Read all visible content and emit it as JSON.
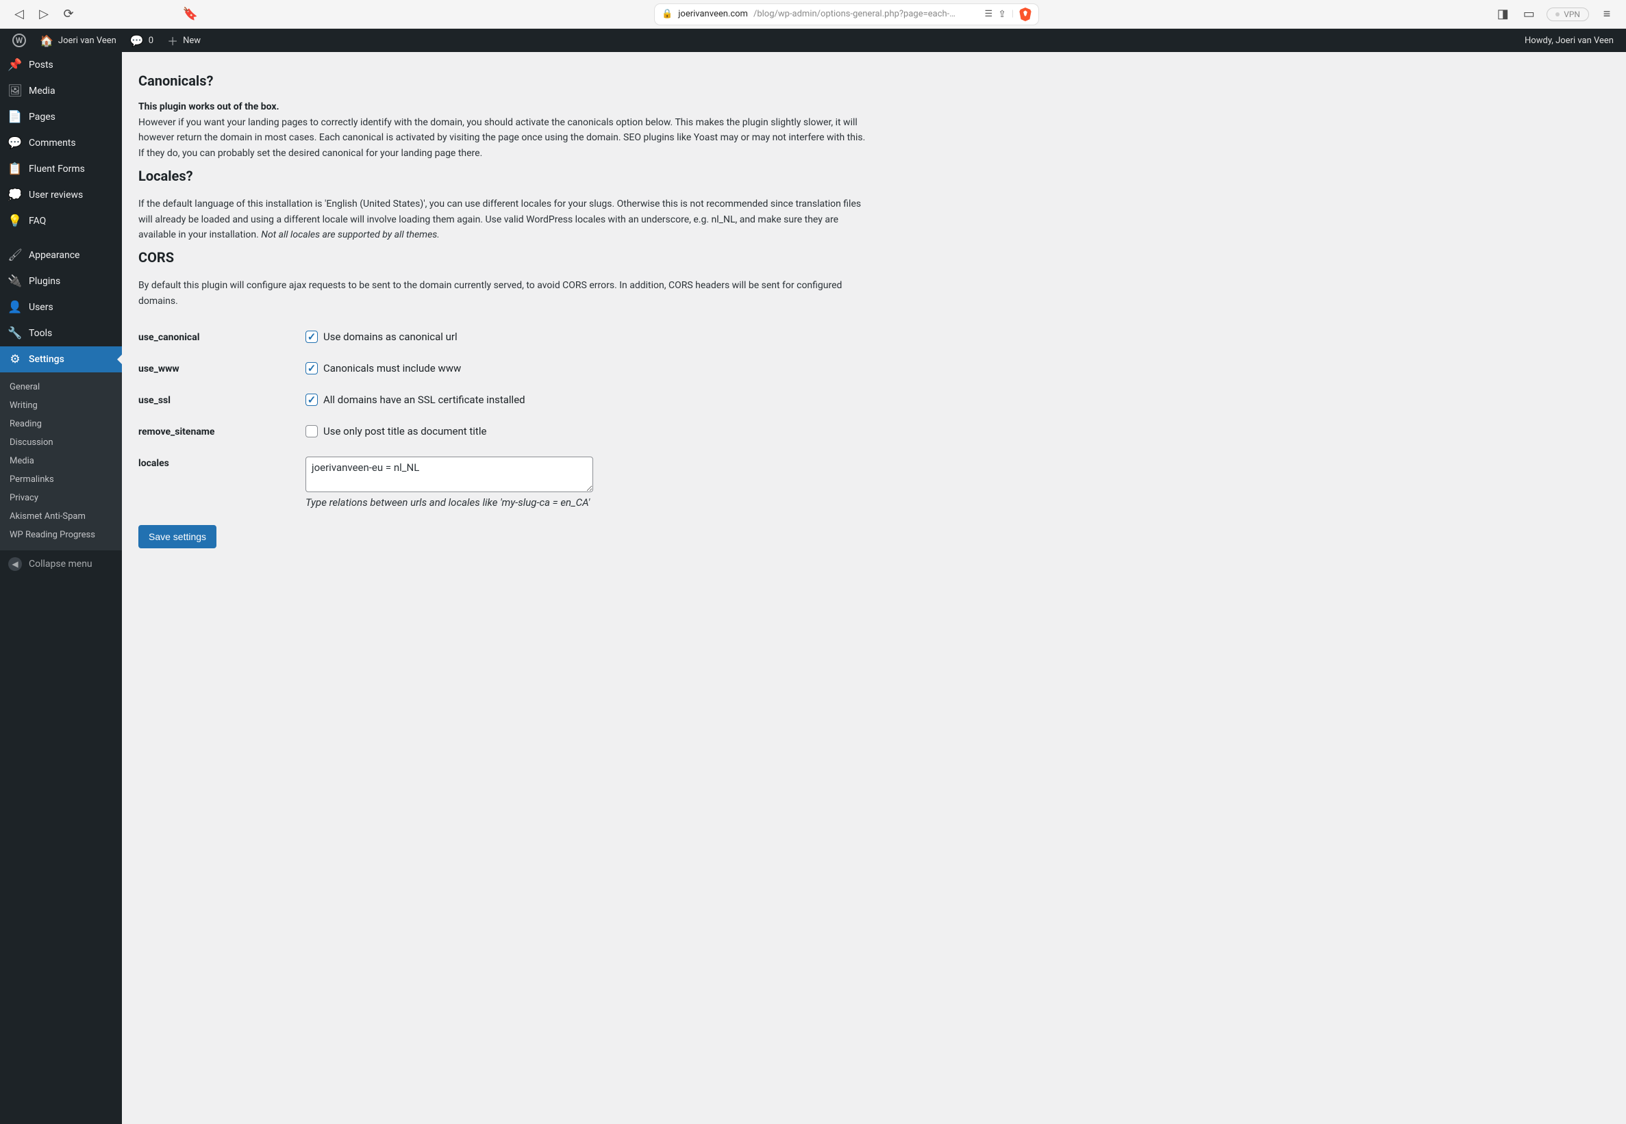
{
  "browser": {
    "url_domain": "joerivanveen.com",
    "url_path": "/blog/wp-admin/options-general.php?page=each-…",
    "vpn_label": "VPN"
  },
  "adminbar": {
    "site_name": "Joeri van Veen",
    "comment_count": "0",
    "new_label": "New",
    "greeting": "Howdy, Joeri van Veen"
  },
  "sidebar": {
    "items": [
      {
        "label": "Posts"
      },
      {
        "label": "Media"
      },
      {
        "label": "Pages"
      },
      {
        "label": "Comments"
      },
      {
        "label": "Fluent Forms"
      },
      {
        "label": "User reviews"
      },
      {
        "label": "FAQ"
      },
      {
        "label": "Appearance"
      },
      {
        "label": "Plugins"
      },
      {
        "label": "Users"
      },
      {
        "label": "Tools"
      },
      {
        "label": "Settings"
      }
    ],
    "submenu": [
      "General",
      "Writing",
      "Reading",
      "Discussion",
      "Media",
      "Permalinks",
      "Privacy",
      "Akismet Anti-Spam",
      "WP Reading Progress"
    ],
    "collapse_label": "Collapse menu"
  },
  "content": {
    "h_canon": "Canonicals?",
    "canon_strong": "This plugin works out of the box.",
    "canon_para": "However if you want your landing pages to correctly identify with the domain, you should activate the canonicals option below. This makes the plugin slightly slower, it will however return the domain in most cases. Each canonical is activated by visiting the page once using the domain. SEO plugins like Yoast may or may not interfere with this. If they do, you can probably set the desired canonical for your landing page there.",
    "h_locales": "Locales?",
    "locales_para_pre": "If the default language of this installation is 'English (United States)', you can use different locales for your slugs. Otherwise this is not recommended since translation files will already be loaded and using a different locale will involve loading them again. Use valid WordPress locales with an underscore, e.g. nl_NL, and make sure they are available in your installation. ",
    "locales_para_em": "Not all locales are supported by all themes.",
    "h_cors": "CORS",
    "cors_para": "By default this plugin will configure ajax requests to be sent to the domain currently served, to avoid CORS errors. In addition, CORS headers will be sent for configured domains.",
    "fields": {
      "use_canonical": {
        "label": "use_canonical",
        "text": "Use domains as canonical url",
        "checked": true
      },
      "use_www": {
        "label": "use_www",
        "text": "Canonicals must include www",
        "checked": true
      },
      "use_ssl": {
        "label": "use_ssl",
        "text": "All domains have an SSL certificate installed",
        "checked": true
      },
      "remove_sitename": {
        "label": "remove_sitename",
        "text": "Use only post title as document title",
        "checked": false
      },
      "locales": {
        "label": "locales",
        "value": "joerivanveen-eu = nl_NL",
        "hint": "Type relations between urls and locales like 'my-slug-ca = en_CA'"
      }
    },
    "save_label": "Save settings"
  }
}
